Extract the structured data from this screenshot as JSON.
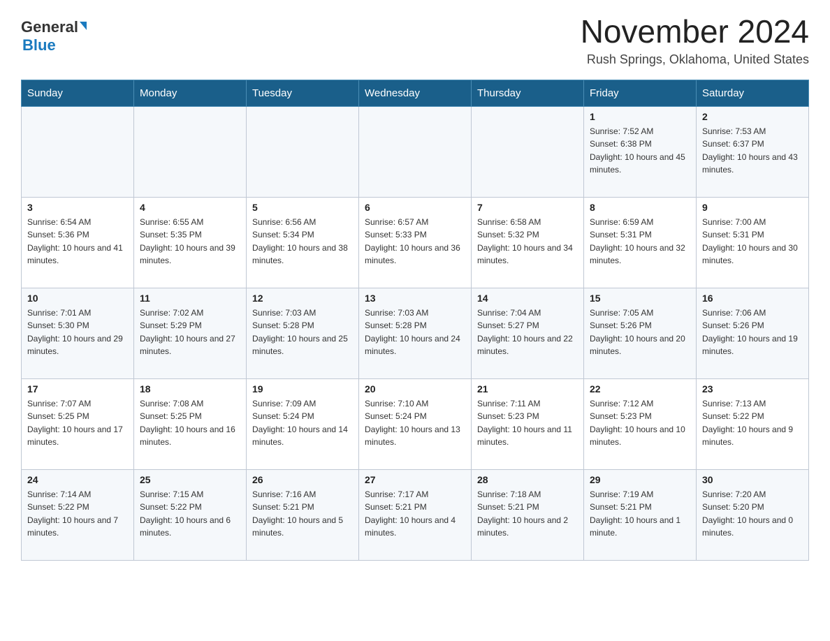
{
  "header": {
    "logo_general": "General",
    "logo_blue": "Blue",
    "month_title": "November 2024",
    "location": "Rush Springs, Oklahoma, United States"
  },
  "calendar": {
    "days_of_week": [
      "Sunday",
      "Monday",
      "Tuesday",
      "Wednesday",
      "Thursday",
      "Friday",
      "Saturday"
    ],
    "weeks": [
      [
        {
          "day": "",
          "sunrise": "",
          "sunset": "",
          "daylight": ""
        },
        {
          "day": "",
          "sunrise": "",
          "sunset": "",
          "daylight": ""
        },
        {
          "day": "",
          "sunrise": "",
          "sunset": "",
          "daylight": ""
        },
        {
          "day": "",
          "sunrise": "",
          "sunset": "",
          "daylight": ""
        },
        {
          "day": "",
          "sunrise": "",
          "sunset": "",
          "daylight": ""
        },
        {
          "day": "1",
          "sunrise": "Sunrise: 7:52 AM",
          "sunset": "Sunset: 6:38 PM",
          "daylight": "Daylight: 10 hours and 45 minutes."
        },
        {
          "day": "2",
          "sunrise": "Sunrise: 7:53 AM",
          "sunset": "Sunset: 6:37 PM",
          "daylight": "Daylight: 10 hours and 43 minutes."
        }
      ],
      [
        {
          "day": "3",
          "sunrise": "Sunrise: 6:54 AM",
          "sunset": "Sunset: 5:36 PM",
          "daylight": "Daylight: 10 hours and 41 minutes."
        },
        {
          "day": "4",
          "sunrise": "Sunrise: 6:55 AM",
          "sunset": "Sunset: 5:35 PM",
          "daylight": "Daylight: 10 hours and 39 minutes."
        },
        {
          "day": "5",
          "sunrise": "Sunrise: 6:56 AM",
          "sunset": "Sunset: 5:34 PM",
          "daylight": "Daylight: 10 hours and 38 minutes."
        },
        {
          "day": "6",
          "sunrise": "Sunrise: 6:57 AM",
          "sunset": "Sunset: 5:33 PM",
          "daylight": "Daylight: 10 hours and 36 minutes."
        },
        {
          "day": "7",
          "sunrise": "Sunrise: 6:58 AM",
          "sunset": "Sunset: 5:32 PM",
          "daylight": "Daylight: 10 hours and 34 minutes."
        },
        {
          "day": "8",
          "sunrise": "Sunrise: 6:59 AM",
          "sunset": "Sunset: 5:31 PM",
          "daylight": "Daylight: 10 hours and 32 minutes."
        },
        {
          "day": "9",
          "sunrise": "Sunrise: 7:00 AM",
          "sunset": "Sunset: 5:31 PM",
          "daylight": "Daylight: 10 hours and 30 minutes."
        }
      ],
      [
        {
          "day": "10",
          "sunrise": "Sunrise: 7:01 AM",
          "sunset": "Sunset: 5:30 PM",
          "daylight": "Daylight: 10 hours and 29 minutes."
        },
        {
          "day": "11",
          "sunrise": "Sunrise: 7:02 AM",
          "sunset": "Sunset: 5:29 PM",
          "daylight": "Daylight: 10 hours and 27 minutes."
        },
        {
          "day": "12",
          "sunrise": "Sunrise: 7:03 AM",
          "sunset": "Sunset: 5:28 PM",
          "daylight": "Daylight: 10 hours and 25 minutes."
        },
        {
          "day": "13",
          "sunrise": "Sunrise: 7:03 AM",
          "sunset": "Sunset: 5:28 PM",
          "daylight": "Daylight: 10 hours and 24 minutes."
        },
        {
          "day": "14",
          "sunrise": "Sunrise: 7:04 AM",
          "sunset": "Sunset: 5:27 PM",
          "daylight": "Daylight: 10 hours and 22 minutes."
        },
        {
          "day": "15",
          "sunrise": "Sunrise: 7:05 AM",
          "sunset": "Sunset: 5:26 PM",
          "daylight": "Daylight: 10 hours and 20 minutes."
        },
        {
          "day": "16",
          "sunrise": "Sunrise: 7:06 AM",
          "sunset": "Sunset: 5:26 PM",
          "daylight": "Daylight: 10 hours and 19 minutes."
        }
      ],
      [
        {
          "day": "17",
          "sunrise": "Sunrise: 7:07 AM",
          "sunset": "Sunset: 5:25 PM",
          "daylight": "Daylight: 10 hours and 17 minutes."
        },
        {
          "day": "18",
          "sunrise": "Sunrise: 7:08 AM",
          "sunset": "Sunset: 5:25 PM",
          "daylight": "Daylight: 10 hours and 16 minutes."
        },
        {
          "day": "19",
          "sunrise": "Sunrise: 7:09 AM",
          "sunset": "Sunset: 5:24 PM",
          "daylight": "Daylight: 10 hours and 14 minutes."
        },
        {
          "day": "20",
          "sunrise": "Sunrise: 7:10 AM",
          "sunset": "Sunset: 5:24 PM",
          "daylight": "Daylight: 10 hours and 13 minutes."
        },
        {
          "day": "21",
          "sunrise": "Sunrise: 7:11 AM",
          "sunset": "Sunset: 5:23 PM",
          "daylight": "Daylight: 10 hours and 11 minutes."
        },
        {
          "day": "22",
          "sunrise": "Sunrise: 7:12 AM",
          "sunset": "Sunset: 5:23 PM",
          "daylight": "Daylight: 10 hours and 10 minutes."
        },
        {
          "day": "23",
          "sunrise": "Sunrise: 7:13 AM",
          "sunset": "Sunset: 5:22 PM",
          "daylight": "Daylight: 10 hours and 9 minutes."
        }
      ],
      [
        {
          "day": "24",
          "sunrise": "Sunrise: 7:14 AM",
          "sunset": "Sunset: 5:22 PM",
          "daylight": "Daylight: 10 hours and 7 minutes."
        },
        {
          "day": "25",
          "sunrise": "Sunrise: 7:15 AM",
          "sunset": "Sunset: 5:22 PM",
          "daylight": "Daylight: 10 hours and 6 minutes."
        },
        {
          "day": "26",
          "sunrise": "Sunrise: 7:16 AM",
          "sunset": "Sunset: 5:21 PM",
          "daylight": "Daylight: 10 hours and 5 minutes."
        },
        {
          "day": "27",
          "sunrise": "Sunrise: 7:17 AM",
          "sunset": "Sunset: 5:21 PM",
          "daylight": "Daylight: 10 hours and 4 minutes."
        },
        {
          "day": "28",
          "sunrise": "Sunrise: 7:18 AM",
          "sunset": "Sunset: 5:21 PM",
          "daylight": "Daylight: 10 hours and 2 minutes."
        },
        {
          "day": "29",
          "sunrise": "Sunrise: 7:19 AM",
          "sunset": "Sunset: 5:21 PM",
          "daylight": "Daylight: 10 hours and 1 minute."
        },
        {
          "day": "30",
          "sunrise": "Sunrise: 7:20 AM",
          "sunset": "Sunset: 5:20 PM",
          "daylight": "Daylight: 10 hours and 0 minutes."
        }
      ]
    ]
  }
}
